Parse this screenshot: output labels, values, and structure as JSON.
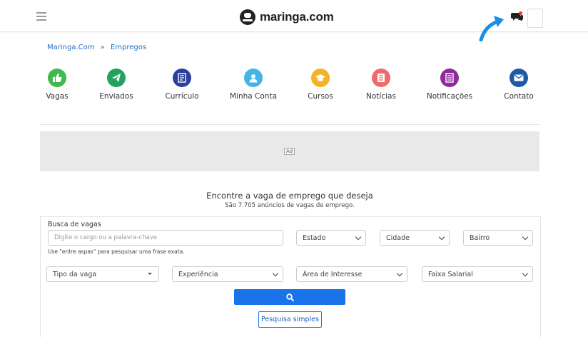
{
  "header": {
    "logo_text": "maringa.com",
    "colors": {
      "arrow": "#1a8fe3",
      "notification_dot": "#e53935"
    }
  },
  "breadcrumb": {
    "items": [
      "Maringa.Com",
      "Empregos"
    ],
    "separator": "»"
  },
  "nav": [
    {
      "label": "Vagas",
      "icon": "thumbs-up-icon",
      "color": "#3fb950"
    },
    {
      "label": "Enviados",
      "icon": "paper-plane-icon",
      "color": "#22a160"
    },
    {
      "label": "Currículo",
      "icon": "document-icon",
      "color": "#2a3f9e"
    },
    {
      "label": "Minha Conta",
      "icon": "user-icon",
      "color": "#41b6e6"
    },
    {
      "label": "Cursos",
      "icon": "graduation-cap-icon",
      "color": "#f5b323"
    },
    {
      "label": "Notícias",
      "icon": "newspaper-icon",
      "color": "#f06a6a"
    },
    {
      "label": "Notificações",
      "icon": "list-icon",
      "color": "#8e2c9c"
    },
    {
      "label": "Contato",
      "icon": "envelope-icon",
      "color": "#1f5aa6"
    }
  ],
  "ad": {
    "badge": "Ad"
  },
  "main": {
    "headline": "Encontre a vaga de emprego que deseja",
    "subheadline": "São 7.705 anúncios de vagas de emprego."
  },
  "search": {
    "label": "Busca de vagas",
    "placeholder": "Digite o cargo ou a palavra-chave",
    "hint": "Use \"entre aspas\" para pesquisar uma frase exata.",
    "estado": "Estado",
    "cidade": "Cidade",
    "bairro": "Bairro",
    "tipo_vaga": "Tipo da vaga",
    "experiencia": "Experiência",
    "area_interesse": "Área de Interesse",
    "faixa_salarial": "Faixa Salarial",
    "simple_search_label": "Pesquisa simples",
    "button_color": "#1a73e8"
  }
}
